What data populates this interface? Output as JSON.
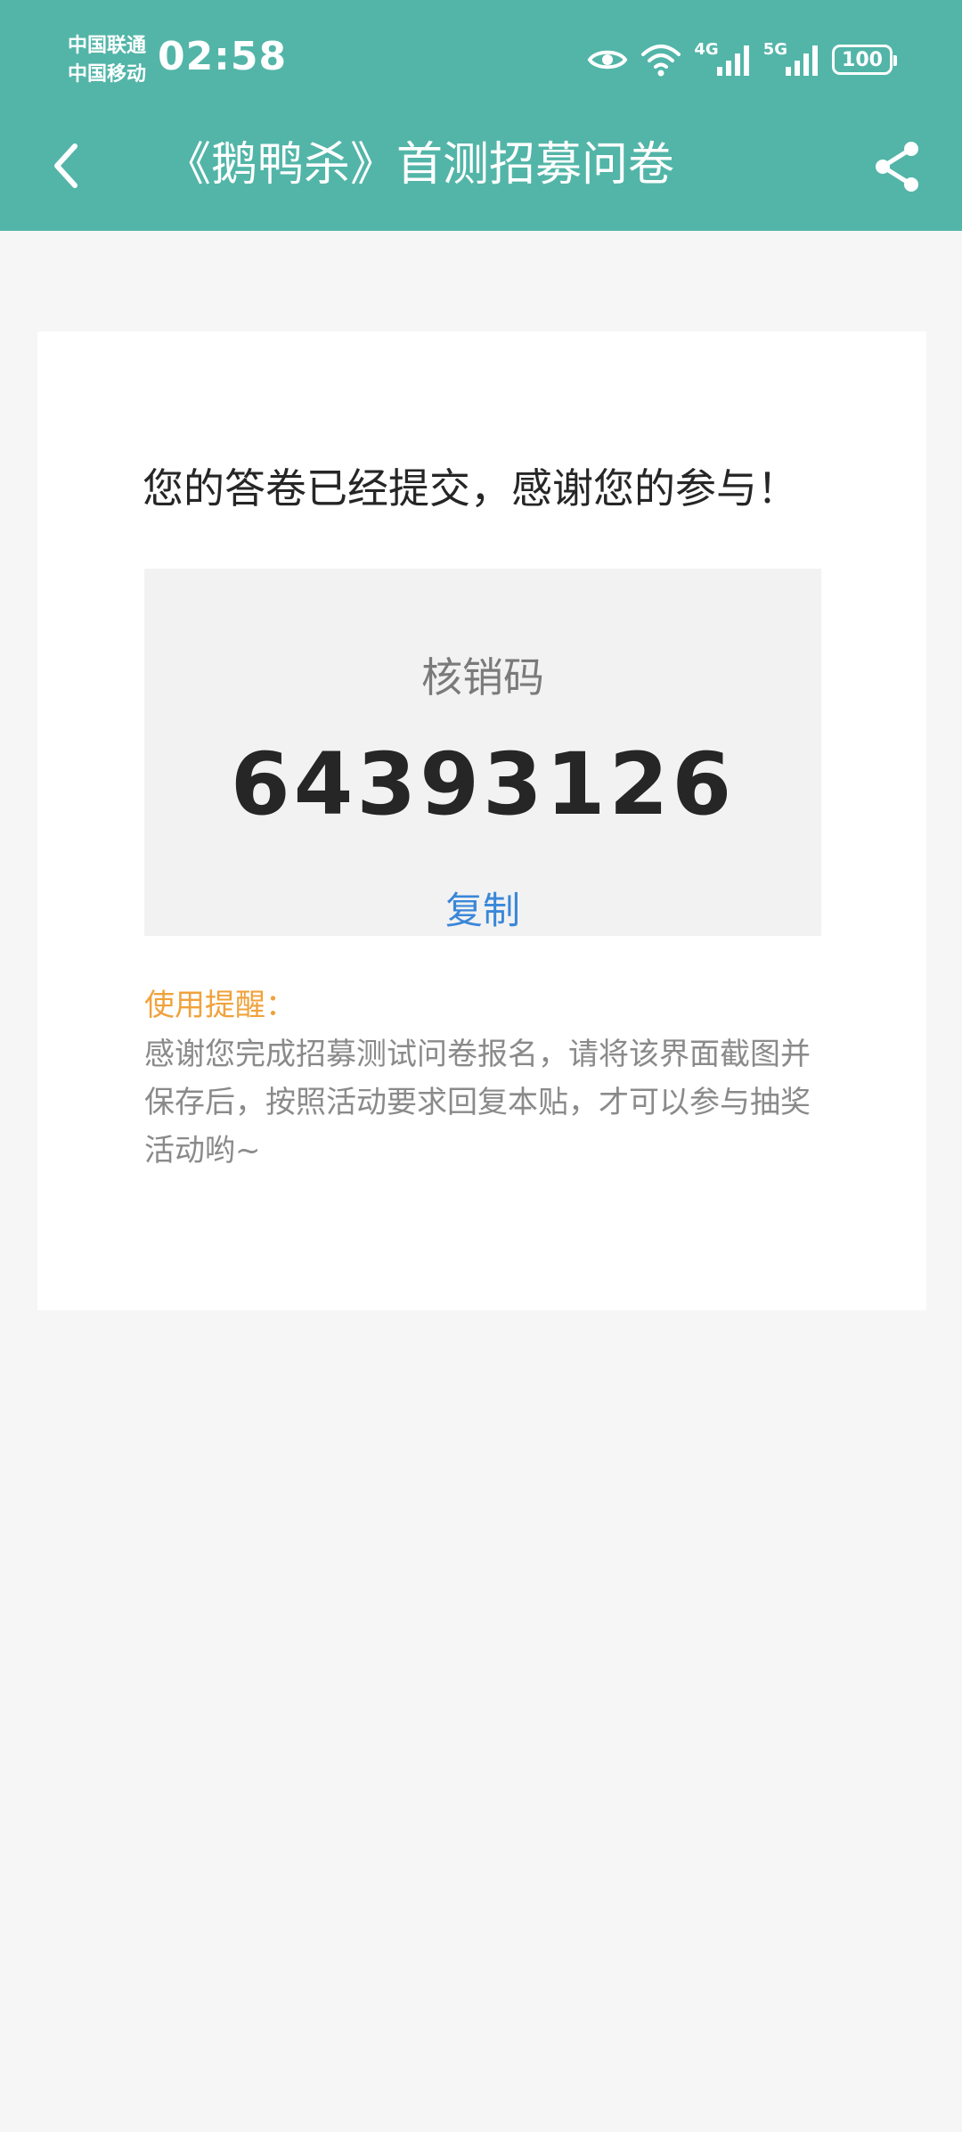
{
  "status_bar": {
    "carrier_1": "中国联通",
    "carrier_2": "中国移动",
    "time": "02:58",
    "network_1": "4G",
    "network_2": "5G",
    "battery": "100",
    "icons": [
      "eye-icon",
      "wifi-icon",
      "signal-icon",
      "signal-icon",
      "battery-icon"
    ]
  },
  "nav": {
    "title": "《鹅鸭杀》首测招募问卷",
    "back_icon": "chevron-left-icon",
    "share_icon": "share-icon"
  },
  "card": {
    "message": "您的答卷已经提交，感谢您的参与！",
    "code_label": "核销码",
    "code_value": "64393126",
    "copy_label": "复制",
    "reminder_title": "使用提醒：",
    "reminder_text": "感谢您完成招募测试问卷报名，请将该界面截图并保存后，按照活动要求回复本贴，才可以参与抽奖活动哟~"
  },
  "colors": {
    "header": "#52b5a8",
    "background": "#f6f6f6",
    "code_box": "#f2f2f2",
    "copy_link": "#3a87d9",
    "reminder_title": "#f0a23c"
  }
}
